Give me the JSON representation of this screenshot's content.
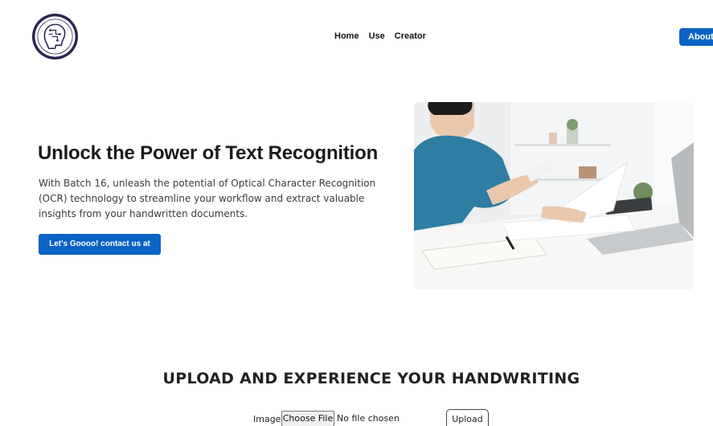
{
  "header": {
    "nav": [
      {
        "label": "Home"
      },
      {
        "label": "Use"
      },
      {
        "label": "Creator"
      }
    ],
    "about_label": "About"
  },
  "hero": {
    "title": "Unlock the Power of Text Recognition",
    "description": "With Batch 16, unleash the potential of Optical Character Recognition (OCR) technology to streamline your workflow and extract valuable insights from your handwritten documents.",
    "cta_label": "Let's Goooo! contact us at"
  },
  "upload": {
    "title": "UPLOAD AND EXPERIENCE YOUR HANDWRITING",
    "image_label": "Image:",
    "choose_label": "Choose File",
    "file_status": "No file chosen",
    "submit_label": "Upload"
  },
  "colors": {
    "accent": "#0b63c5"
  }
}
